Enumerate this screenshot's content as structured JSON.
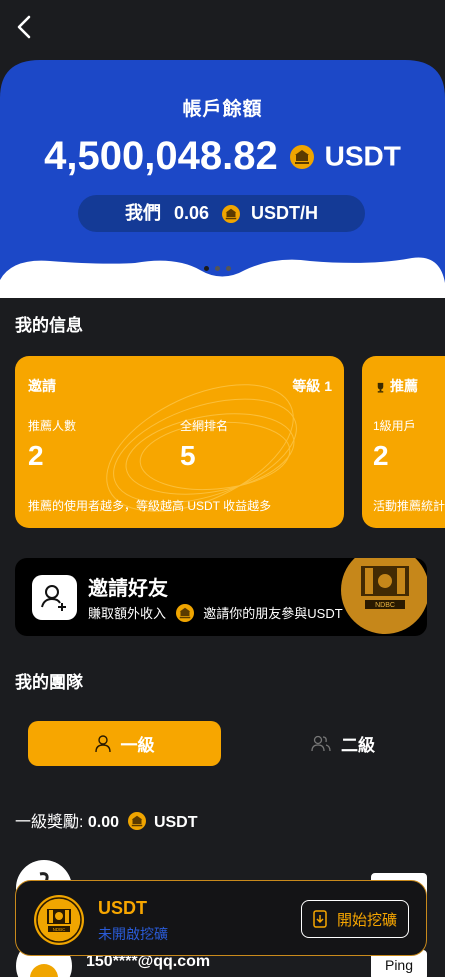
{
  "header": {
    "back_icon": "chevron-left-icon"
  },
  "balance": {
    "title": "帳戶餘額",
    "amount": "4,500,048.82",
    "currency": "USDT",
    "rate_prefix": "我們",
    "rate_value": "0.06",
    "rate_unit": "USDT/H"
  },
  "sections": {
    "my_info": "我的信息",
    "my_team": "我的團隊"
  },
  "cards": [
    {
      "title": "邀請",
      "level": "等級 1",
      "stat1_label": "推薦人數",
      "stat1_value": "2",
      "stat2_label": "全網排名",
      "stat2_value": "5",
      "footer": "推薦的使用者越多，等級越高 USDT 收益越多"
    },
    {
      "title": "推薦",
      "stat1_label": "1級用戶",
      "stat1_value": "2",
      "footer": "活動推薦統計"
    }
  ],
  "invite": {
    "title": "邀請好友",
    "sub_left": "賺取額外收入",
    "sub_right": "邀請你的朋友參與USDT",
    "badge_text": "NDBC"
  },
  "team_tabs": [
    {
      "label": "一級",
      "active": true
    },
    {
      "label": "二級",
      "active": false
    }
  ],
  "reward": {
    "label": "一級獎勵:",
    "value": "0.00",
    "unit": "USDT"
  },
  "members": [
    {
      "email": "150****@qq.com",
      "button": "Ping"
    }
  ],
  "mining": {
    "title": "USDT",
    "status": "未開啟挖礦",
    "button": "開始挖礦",
    "badge_text": "NDBC"
  },
  "colors": {
    "accent": "#f7a600",
    "brand_blue": "#1c48c7",
    "background": "#1b1c1f"
  }
}
